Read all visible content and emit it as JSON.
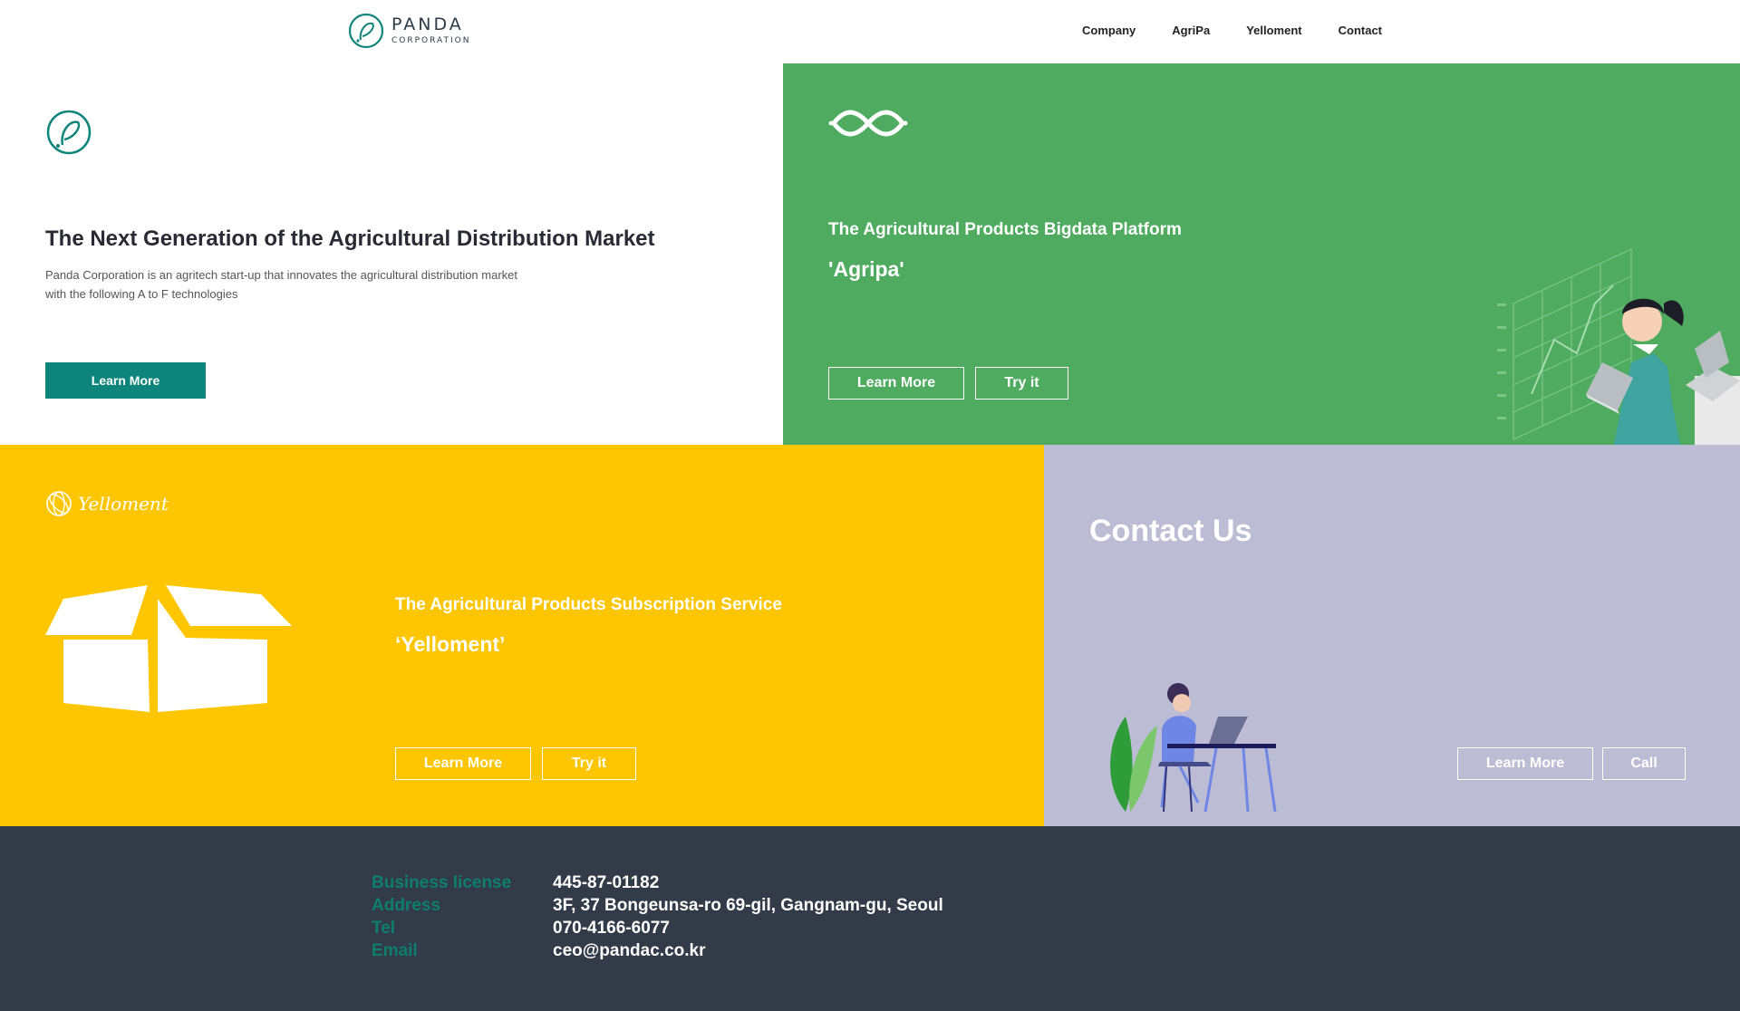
{
  "header": {
    "brand": "PANDA",
    "brand_sub": "CORPORATION",
    "nav": [
      "Company",
      "AgriPa",
      "Yelloment",
      "Contact"
    ]
  },
  "hero": {
    "title": "The Next Generation of the Agricultural Distribution Market",
    "desc_line1": "Panda Corporation is an agritech start-up that innovates the agricultural distribution market",
    "desc_line2": "with the following A to F technologies",
    "learn_more": "Learn More"
  },
  "agripa": {
    "subtitle": "The Agricultural Products Bigdata Platform",
    "name": "'Agripa'",
    "learn_more": "Learn More",
    "try_it": "Try it"
  },
  "yelloment": {
    "logo_text": "Yelloment",
    "subtitle": "The Agricultural Products Subscription Service",
    "name": "‘Yelloment’",
    "learn_more": "Learn More",
    "try_it": "Try it"
  },
  "contact": {
    "title": "Contact Us",
    "learn_more": "Learn More",
    "call": "Call"
  },
  "footer": {
    "business_license_label": "Business license",
    "business_license": "445-87-01182",
    "address_label": "Address",
    "address": "3F, 37 Bongeunsa-ro 69-gil, Gangnam-gu, Seoul",
    "tel_label": "Tel",
    "tel": "070-4166-6077",
    "email_label": "Email",
    "email": "ceo@pandac.co.kr"
  },
  "colors": {
    "teal": "#0e857a",
    "green": "#4fab60",
    "yellow": "#fec600",
    "lavender": "#bdbcd5",
    "footer": "#323b47"
  }
}
